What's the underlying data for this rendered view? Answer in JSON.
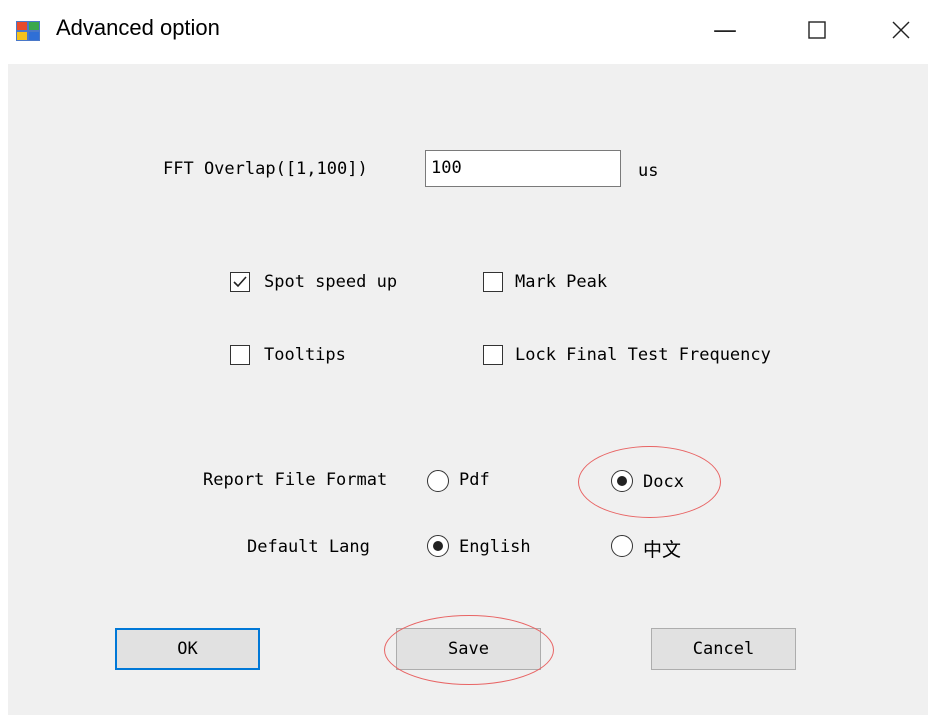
{
  "window": {
    "title": "Advanced option",
    "minimize_glyph": "—",
    "maximize_glyph": "☐",
    "close_glyph": "✕"
  },
  "fft": {
    "label": "FFT Overlap([1,100])",
    "value": "100",
    "unit": "us"
  },
  "options": {
    "spot_speed_up": {
      "label": "Spot speed up",
      "checked": true
    },
    "mark_peak": {
      "label": "Mark Peak",
      "checked": false
    },
    "tooltips": {
      "label": "Tooltips",
      "checked": false
    },
    "lock_final": {
      "label": "Lock Final Test Frequency",
      "checked": false
    }
  },
  "report_format": {
    "label": "Report File Format",
    "pdf": "Pdf",
    "docx": "Docx",
    "selected": "Docx"
  },
  "default_lang": {
    "label": "Default Lang",
    "english": "English",
    "chinese": "中文",
    "selected": "English"
  },
  "buttons": {
    "ok": "OK",
    "save": "Save",
    "cancel": "Cancel"
  },
  "colors": {
    "annotation": "#e86464",
    "focus_border": "#0078d7"
  }
}
